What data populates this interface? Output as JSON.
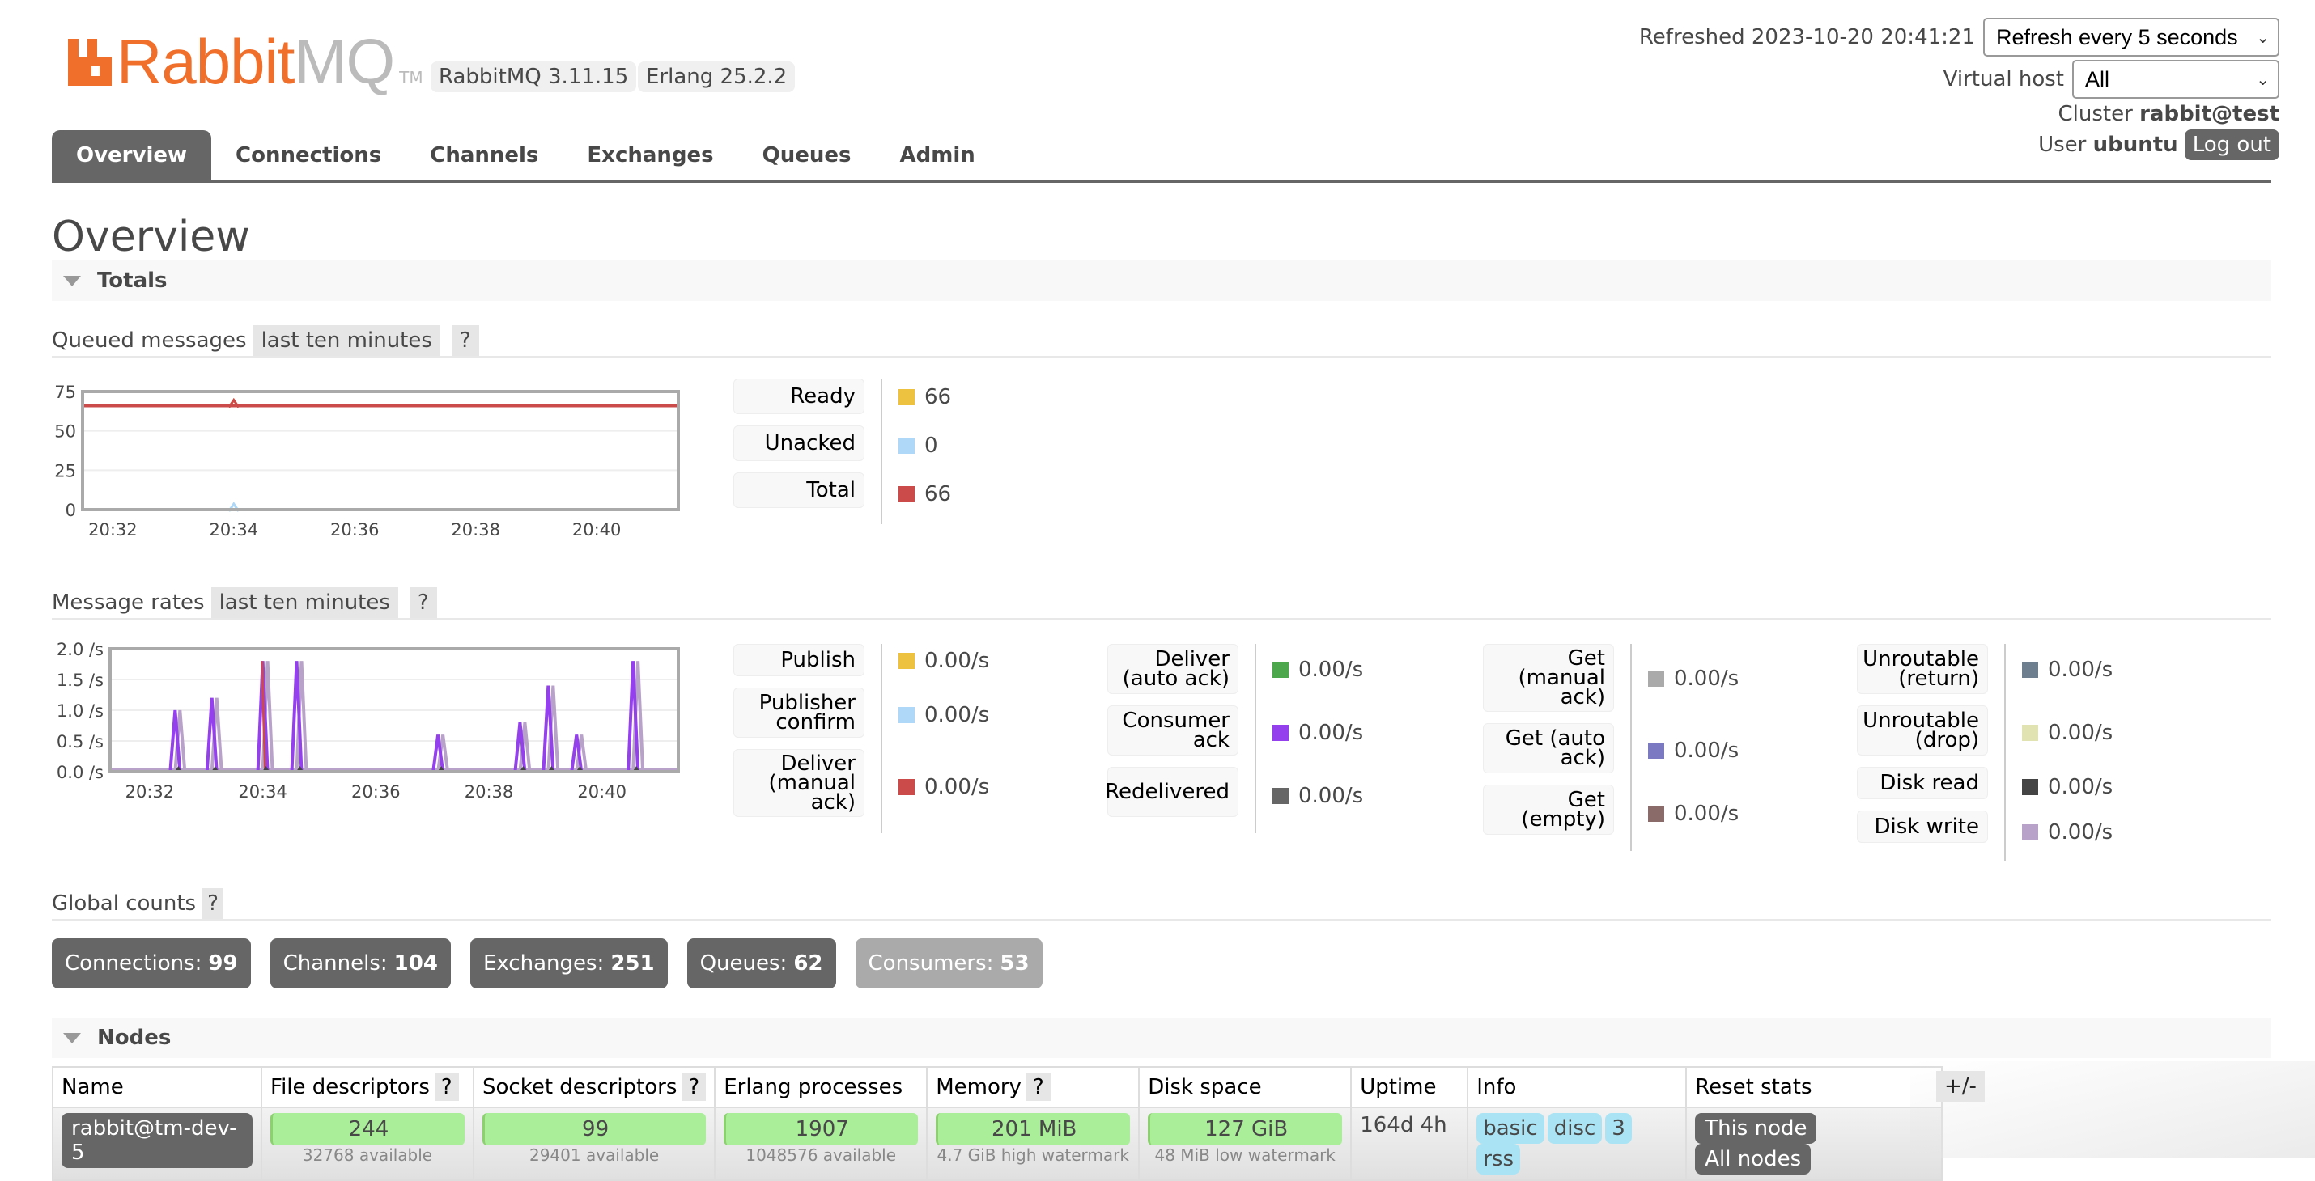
{
  "header": {
    "logo_rabbit": "Rabbit",
    "logo_mq": "MQ",
    "logo_tm": "TM",
    "rabbitmq_version": "RabbitMQ 3.11.15",
    "erlang_version": "Erlang 25.2.2",
    "refreshed_label": "Refreshed 2023-10-20 20:41:21",
    "refresh_select": "Refresh every 5 seconds",
    "vhost_label": "Virtual host",
    "vhost_select": "All",
    "cluster_label": "Cluster",
    "cluster_name": "rabbit@test",
    "user_label": "User",
    "user_name": "ubuntu",
    "logout_label": "Log out"
  },
  "tabs": [
    {
      "label": "Overview",
      "active": true
    },
    {
      "label": "Connections"
    },
    {
      "label": "Channels"
    },
    {
      "label": "Exchanges"
    },
    {
      "label": "Queues"
    },
    {
      "label": "Admin"
    }
  ],
  "page_title": "Overview",
  "totals": {
    "section_label": "Totals",
    "queued": {
      "label": "Queued messages",
      "range": "last ten minutes",
      "help": "?",
      "legend": [
        {
          "label": "Ready",
          "value": "66",
          "color": "#edc240"
        },
        {
          "label": "Unacked",
          "value": "0",
          "color": "#afd8f8"
        },
        {
          "label": "Total",
          "value": "66",
          "color": "#cb4b4b"
        }
      ]
    },
    "rates": {
      "label": "Message rates",
      "range": "last ten minutes",
      "help": "?",
      "legend_cols": [
        [
          {
            "label": "Publish",
            "value": "0.00/s",
            "color": "#edc240"
          },
          {
            "label": "Publisher confirm",
            "value": "0.00/s",
            "color": "#afd8f8"
          },
          {
            "label": "Deliver (manual ack)",
            "value": "0.00/s",
            "color": "#cb4b4b"
          }
        ],
        [
          {
            "label": "Deliver (auto ack)",
            "value": "0.00/s",
            "color": "#4da74d"
          },
          {
            "label": "Consumer ack",
            "value": "0.00/s",
            "color": "#9440ed"
          },
          {
            "label": "Redelivered",
            "value": "0.00/s",
            "color": "#666666"
          }
        ],
        [
          {
            "label": "Get (manual ack)",
            "value": "0.00/s",
            "color": "#aaaaaa"
          },
          {
            "label": "Get (auto ack)",
            "value": "0.00/s",
            "color": "#7c79c3"
          },
          {
            "label": "Get (empty)",
            "value": "0.00/s",
            "color": "#8b6b69"
          }
        ],
        [
          {
            "label": "Unroutable (return)",
            "value": "0.00/s",
            "color": "#6e7f8f"
          },
          {
            "label": "Unroutable (drop)",
            "value": "0.00/s",
            "color": "#e1e3b3"
          },
          {
            "label": "Disk read",
            "value": "0.00/s",
            "color": "#444444"
          },
          {
            "label": "Disk write",
            "value": "0.00/s",
            "color": "#b9a2c9"
          }
        ]
      ]
    },
    "global_counts": {
      "label": "Global counts",
      "help": "?",
      "items": [
        {
          "label": "Connections:",
          "value": "99"
        },
        {
          "label": "Channels:",
          "value": "104"
        },
        {
          "label": "Exchanges:",
          "value": "251"
        },
        {
          "label": "Queues:",
          "value": "62"
        },
        {
          "label": "Consumers:",
          "value": "53",
          "dim": true
        }
      ]
    }
  },
  "nodes": {
    "section_label": "Nodes",
    "columns": [
      "Name",
      "File descriptors",
      "Socket descriptors",
      "Erlang processes",
      "Memory",
      "Disk space",
      "Uptime",
      "Info",
      "Reset stats"
    ],
    "help": "?",
    "plus_minus": "+/-",
    "rows": [
      {
        "name": "rabbit@tm-dev-5",
        "fd": "244",
        "fd_sub": "32768 available",
        "sockets": "99",
        "sockets_sub": "29401 available",
        "procs": "1907",
        "procs_sub": "1048576 available",
        "memory": "201 MiB",
        "memory_sub": "4.7 GiB high watermark",
        "disk": "127 GiB",
        "disk_sub": "48 MiB low watermark",
        "uptime": "164d 4h",
        "info": [
          "basic",
          "disc",
          "3",
          "rss"
        ],
        "reset_this": "This node",
        "reset_all": "All nodes"
      }
    ]
  },
  "chart_data": [
    {
      "type": "line",
      "title": "Queued messages (last ten minutes)",
      "xlabel": "",
      "ylabel": "",
      "x_ticks": [
        "20:32",
        "20:34",
        "20:36",
        "20:38",
        "20:40"
      ],
      "y_ticks": [
        "0",
        "25",
        "50",
        "75"
      ],
      "ylim": [
        0,
        75
      ],
      "xlim_minutes": [
        31.5,
        41.35
      ],
      "grid": true,
      "series": [
        {
          "name": "Ready",
          "color": "#edc240",
          "x": [
            31.5,
            34.0,
            41.35
          ],
          "y": [
            66,
            66,
            66
          ],
          "marker_at": 34.0
        },
        {
          "name": "Unacked",
          "color": "#afd8f8",
          "x": [
            31.5,
            34.0,
            41.35
          ],
          "y": [
            0,
            0,
            0
          ],
          "marker_at": 34.0
        },
        {
          "name": "Total",
          "color": "#cb4b4b",
          "x": [
            31.5,
            34.0,
            41.35
          ],
          "y": [
            66,
            66,
            66
          ],
          "marker_at": 34.0
        }
      ]
    },
    {
      "type": "line",
      "title": "Message rates (last ten minutes)",
      "xlabel": "",
      "ylabel": "",
      "x_ticks": [
        "20:32",
        "20:34",
        "20:36",
        "20:38",
        "20:40"
      ],
      "y_ticks": [
        "0.0 /s",
        "0.5 /s",
        "1.0 /s",
        "1.5 /s",
        "2.0 /s"
      ],
      "ylim": [
        0,
        2.0
      ],
      "xlim_minutes": [
        31.3,
        41.35
      ],
      "grid": true,
      "spikes": [
        {
          "t": 32.45,
          "consumer_ack": 1.0
        },
        {
          "t": 33.1,
          "consumer_ack": 1.2
        },
        {
          "t": 34.0,
          "consumer_ack": 1.8,
          "deliver_manual": 1.8
        },
        {
          "t": 34.6,
          "consumer_ack": 1.8
        },
        {
          "t": 37.1,
          "consumer_ack": 0.6
        },
        {
          "t": 38.55,
          "consumer_ack": 0.8
        },
        {
          "t": 39.05,
          "consumer_ack": 1.4
        },
        {
          "t": 39.55,
          "consumer_ack": 0.6
        },
        {
          "t": 40.55,
          "consumer_ack": 1.8
        }
      ],
      "series_colors": {
        "consumer_ack": "#9440ed",
        "disk_write": "#b9a2c9",
        "deliver_manual": "#cb4b4b"
      }
    }
  ]
}
